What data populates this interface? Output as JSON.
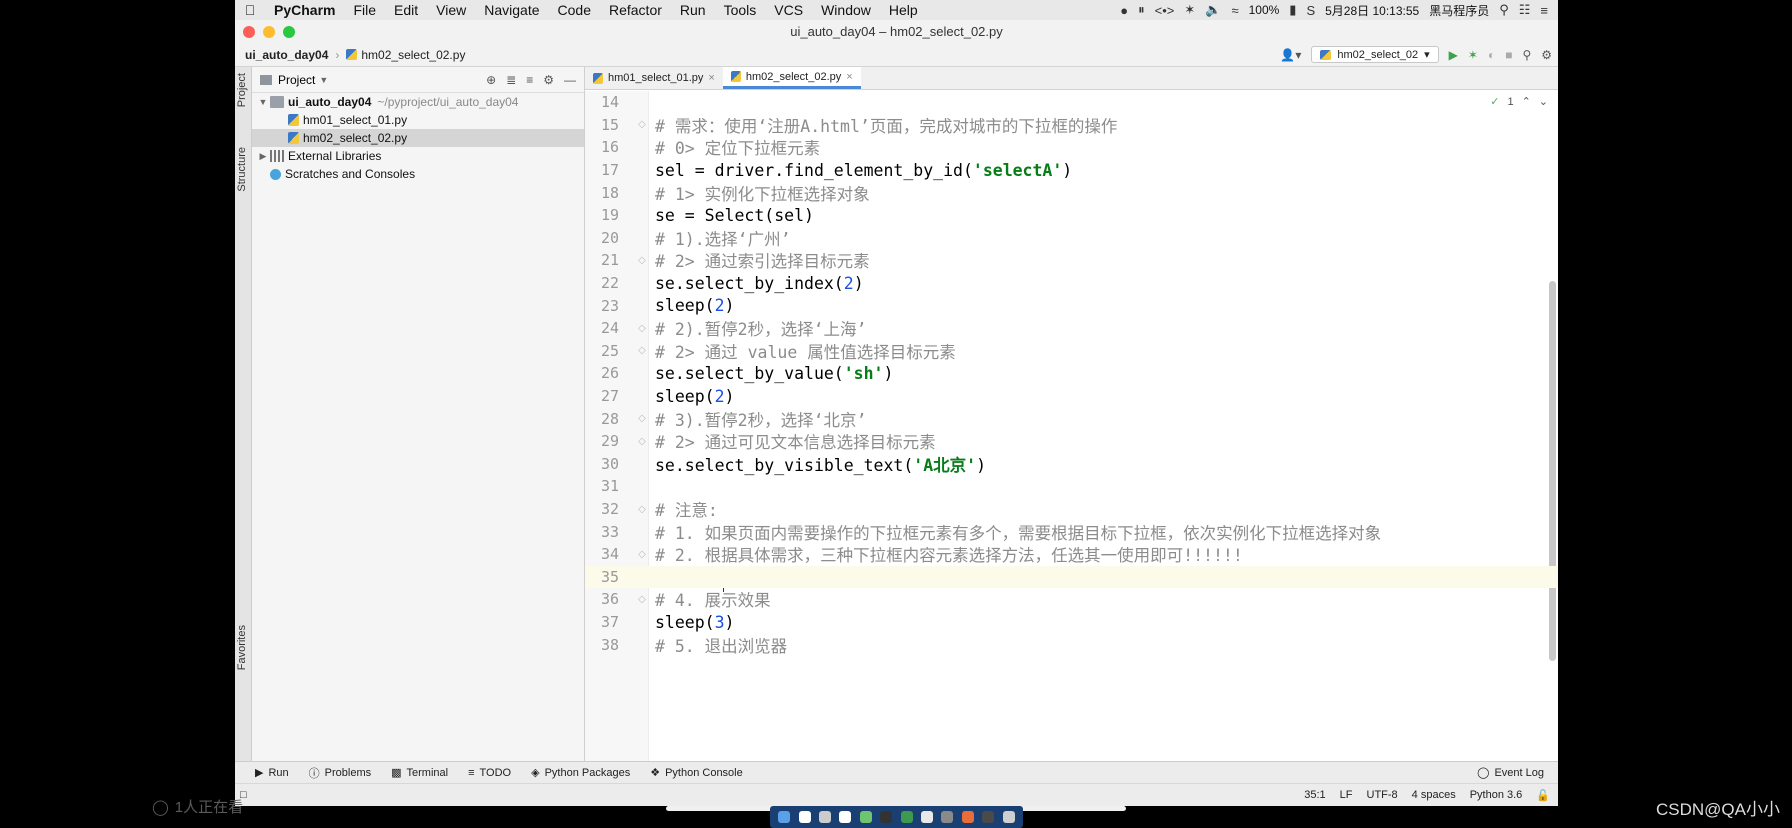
{
  "menubar": {
    "app": "PyCharm",
    "items": [
      "File",
      "Edit",
      "View",
      "Navigate",
      "Code",
      "Refactor",
      "Run",
      "Tools",
      "VCS",
      "Window",
      "Help"
    ],
    "battery": "100%",
    "datetime": "5月28日 10:13:55",
    "user": "黑马程序员"
  },
  "window": {
    "title": "ui_auto_day04 – hm02_select_02.py"
  },
  "navbar": {
    "project": "ui_auto_day04",
    "file": "hm02_select_02.py",
    "run_config": "hm02_select_02"
  },
  "sidebar_tabs": {
    "project": "Project",
    "structure": "Structure",
    "favorites": "Favorites"
  },
  "project_panel": {
    "header": "Project",
    "root": "ui_auto_day04",
    "root_path": "~/pyproject/ui_auto_day04",
    "files": [
      "hm01_select_01.py",
      "hm02_select_02.py"
    ],
    "external": "External Libraries",
    "scratches": "Scratches and Consoles"
  },
  "editor": {
    "tabs": [
      "hm01_select_01.py",
      "hm02_select_02.py"
    ],
    "inspection_count": "1",
    "lines": [
      {
        "n": "14",
        "t": ""
      },
      {
        "n": "15",
        "t": "# 需求：使用‘注册A.html’页面，完成对城市的下拉框的操作"
      },
      {
        "n": "16",
        "t": "# 0> 定位下拉框元素"
      },
      {
        "n": "17",
        "t": "sel = driver.find_element_by_id('selectA')"
      },
      {
        "n": "18",
        "t": "# 1> 实例化下拉框选择对象"
      },
      {
        "n": "19",
        "t": "se = Select(sel)"
      },
      {
        "n": "20",
        "t": "# 1).选择‘广州’"
      },
      {
        "n": "21",
        "t": "# 2> 通过索引选择目标元素"
      },
      {
        "n": "22",
        "t": "se.select_by_index(2)"
      },
      {
        "n": "23",
        "t": "sleep(2)"
      },
      {
        "n": "24",
        "t": "# 2).暂停2秒，选择‘上海’"
      },
      {
        "n": "25",
        "t": "# 2> 通过 value 属性值选择目标元素"
      },
      {
        "n": "26",
        "t": "se.select_by_value('sh')"
      },
      {
        "n": "27",
        "t": "sleep(2)"
      },
      {
        "n": "28",
        "t": "# 3).暂停2秒，选择‘北京’"
      },
      {
        "n": "29",
        "t": "# 2> 通过可见文本信息选择目标元素"
      },
      {
        "n": "30",
        "t": "se.select_by_visible_text('A北京')"
      },
      {
        "n": "31",
        "t": ""
      },
      {
        "n": "32",
        "t": "# 注意:"
      },
      {
        "n": "33",
        "t": "# 1. 如果页面内需要操作的下拉框元素有多个，需要根据目标下拉框，依次实例化下拉框选择对象"
      },
      {
        "n": "34",
        "t": "# 2. 根据具体需求，三种下拉框内容元素选择方法，任选其一使用即可!!!!!!"
      },
      {
        "n": "35",
        "t": ""
      },
      {
        "n": "36",
        "t": "# 4. 展示效果"
      },
      {
        "n": "37",
        "t": "sleep(3)"
      },
      {
        "n": "38",
        "t": "# 5. 退出浏览器"
      }
    ]
  },
  "bottom_tools": [
    "Run",
    "Problems",
    "Terminal",
    "TODO",
    "Python Packages",
    "Python Console"
  ],
  "event_log": "Event Log",
  "status": {
    "position": "35:1",
    "line_sep": "LF",
    "encoding": "UTF-8",
    "indent": "4 spaces",
    "interpreter": "Python 3.6"
  },
  "overlay": {
    "viewers": "1人正在看",
    "watermark": "CSDN@QA小小"
  },
  "colors": {
    "accent": "#4a88d8",
    "string": "#067d17",
    "number": "#1750eb",
    "comment": "#8c8c8c"
  }
}
